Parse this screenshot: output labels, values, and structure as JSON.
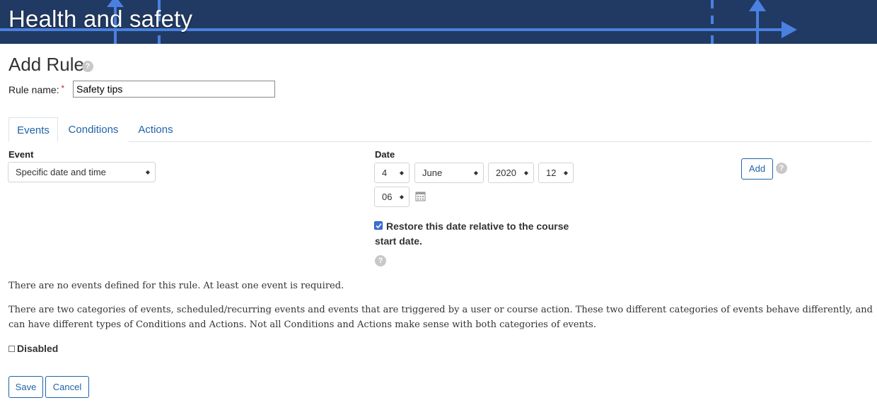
{
  "banner": {
    "title": "Health and safety"
  },
  "page": {
    "heading": "Add Rule",
    "help_glyph": "?"
  },
  "rule": {
    "label": "Rule name:",
    "required_mark": "*",
    "value": "Safety tips"
  },
  "tabs": [
    {
      "label": "Events",
      "active": true
    },
    {
      "label": "Conditions",
      "active": false
    },
    {
      "label": "Actions",
      "active": false
    }
  ],
  "event": {
    "label": "Event",
    "selected": "Specific date and time"
  },
  "date": {
    "label": "Date",
    "day": "4",
    "month": "June",
    "year": "2020",
    "hour": "12",
    "minute": "06",
    "restore_checked": true,
    "restore_label": "Restore this date relative to the course start date."
  },
  "add_button": {
    "label": "Add"
  },
  "messages": {
    "no_events": "There are no events defined for this rule. At least one event is required.",
    "categories": "There are two categories of events, scheduled/recurring events and events that are triggered by a user or course action. These two different categories of events behave differently, and can have different types of Conditions and Actions. Not all Conditions and Actions make sense with both categories of events."
  },
  "disabled": {
    "label": "Disabled",
    "checked": false
  },
  "footer": {
    "save_label": "Save",
    "cancel_label": "Cancel"
  },
  "icons": {
    "help": "help-circle-icon",
    "calendar": "calendar-icon",
    "caret": "select-caret-icon",
    "check": "checkmark-icon"
  },
  "colors": {
    "banner": "#213a63",
    "banner_arrows": "#4a80e0",
    "link": "#1f63a8",
    "checkbox": "#3a6fd8"
  }
}
